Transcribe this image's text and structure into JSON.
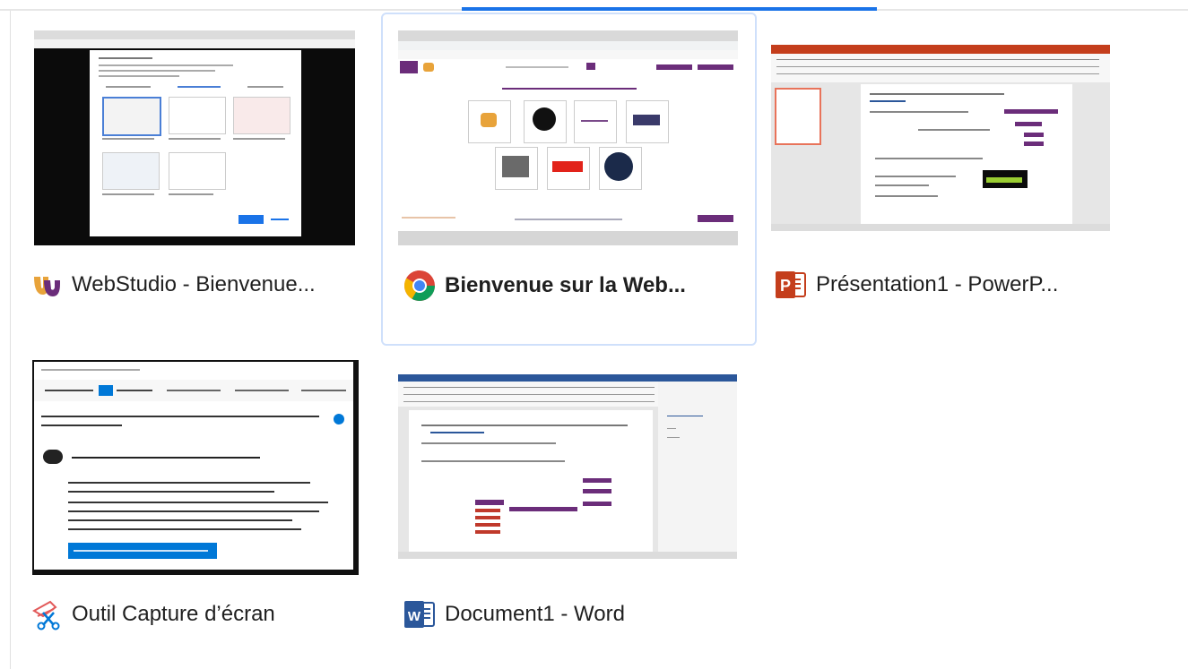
{
  "windows": [
    {
      "title": "WebStudio - Bienvenue...",
      "icon": "webstudio-icon",
      "selected": false
    },
    {
      "title": "Bienvenue sur la Web...",
      "icon": "chrome-icon",
      "selected": true
    },
    {
      "title": "Présentation1 - PowerP...",
      "icon": "powerpoint-icon",
      "selected": false
    },
    {
      "title": "Outil Capture d’écran",
      "icon": "snipping-tool-icon",
      "selected": false
    },
    {
      "title": "Document1 - Word",
      "icon": "word-icon",
      "selected": false
    }
  ],
  "colors": {
    "accent": "#1a73e8",
    "selection_border": "#cfe0fb",
    "webstudio_purple": "#6b2d7a",
    "powerpoint": "#c43e1c",
    "word": "#2b579a",
    "snip_blue": "#0078d7"
  }
}
